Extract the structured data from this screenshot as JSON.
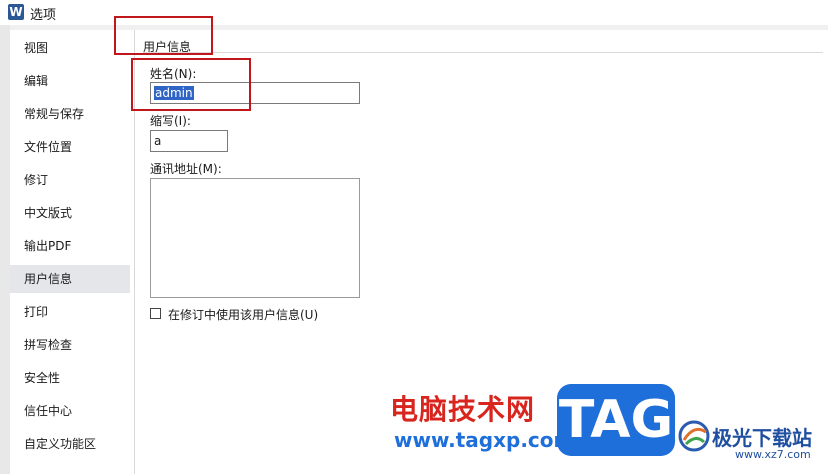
{
  "window": {
    "title": "选项",
    "app_icon_letter": "W"
  },
  "sidebar": {
    "items": [
      {
        "label": "视图"
      },
      {
        "label": "编辑"
      },
      {
        "label": "常规与保存"
      },
      {
        "label": "文件位置"
      },
      {
        "label": "修订"
      },
      {
        "label": "中文版式"
      },
      {
        "label": "输出PDF"
      },
      {
        "label": "用户信息",
        "selected": true
      },
      {
        "label": "打印"
      },
      {
        "label": "拼写检查"
      },
      {
        "label": "安全性"
      },
      {
        "label": "信任中心"
      },
      {
        "label": "自定义功能区"
      }
    ]
  },
  "user_info": {
    "group_title": "用户信息",
    "name_label": "姓名(N):",
    "name_value": "admin",
    "initials_label": "缩写(I):",
    "initials_value": "a",
    "address_label": "通讯地址(M):",
    "address_value": "",
    "use_in_revisions_label": "在修订中使用该用户信息(U)",
    "use_in_revisions_checked": false
  },
  "watermark": {
    "site_name": "电脑技术网",
    "site_url": "www.tagxp.com",
    "logo_text": "TAG",
    "site2_name": "极光下载站",
    "site2_url": "www.xz7.com"
  },
  "colors": {
    "highlight": "#c0161c",
    "selection": "#2f66c6",
    "accent": "#1e6fd9"
  }
}
